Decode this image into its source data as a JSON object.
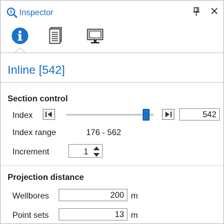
{
  "window": {
    "title": "Inspector",
    "icons": {
      "title": "inspector-magnifier-icon",
      "pin": "pin-icon",
      "close": "close-icon"
    }
  },
  "tabs": [
    {
      "name": "info",
      "icon": "info-icon",
      "selected": true
    },
    {
      "name": "document",
      "icon": "document-icon",
      "selected": false
    },
    {
      "name": "monitor",
      "icon": "monitor-icon",
      "selected": false
    }
  ],
  "object": {
    "title": "Inline [542]"
  },
  "section_control": {
    "title": "Section control",
    "index_label": "Index",
    "index_value": "542",
    "slider_fraction": 0.95,
    "index_range_label": "Index range",
    "index_range_value": "176 - 562",
    "increment_label": "Increment",
    "increment_value": "1"
  },
  "projection_distance": {
    "title": "Projection distance",
    "wellbores_label": "Wellbores",
    "wellbores_value": "200",
    "wellbores_unit": "m",
    "pointsets_label": "Point sets",
    "pointsets_value": "13",
    "pointsets_unit": "m"
  },
  "colors": {
    "accent": "#1a73c9",
    "title": "#1e6cc8"
  }
}
